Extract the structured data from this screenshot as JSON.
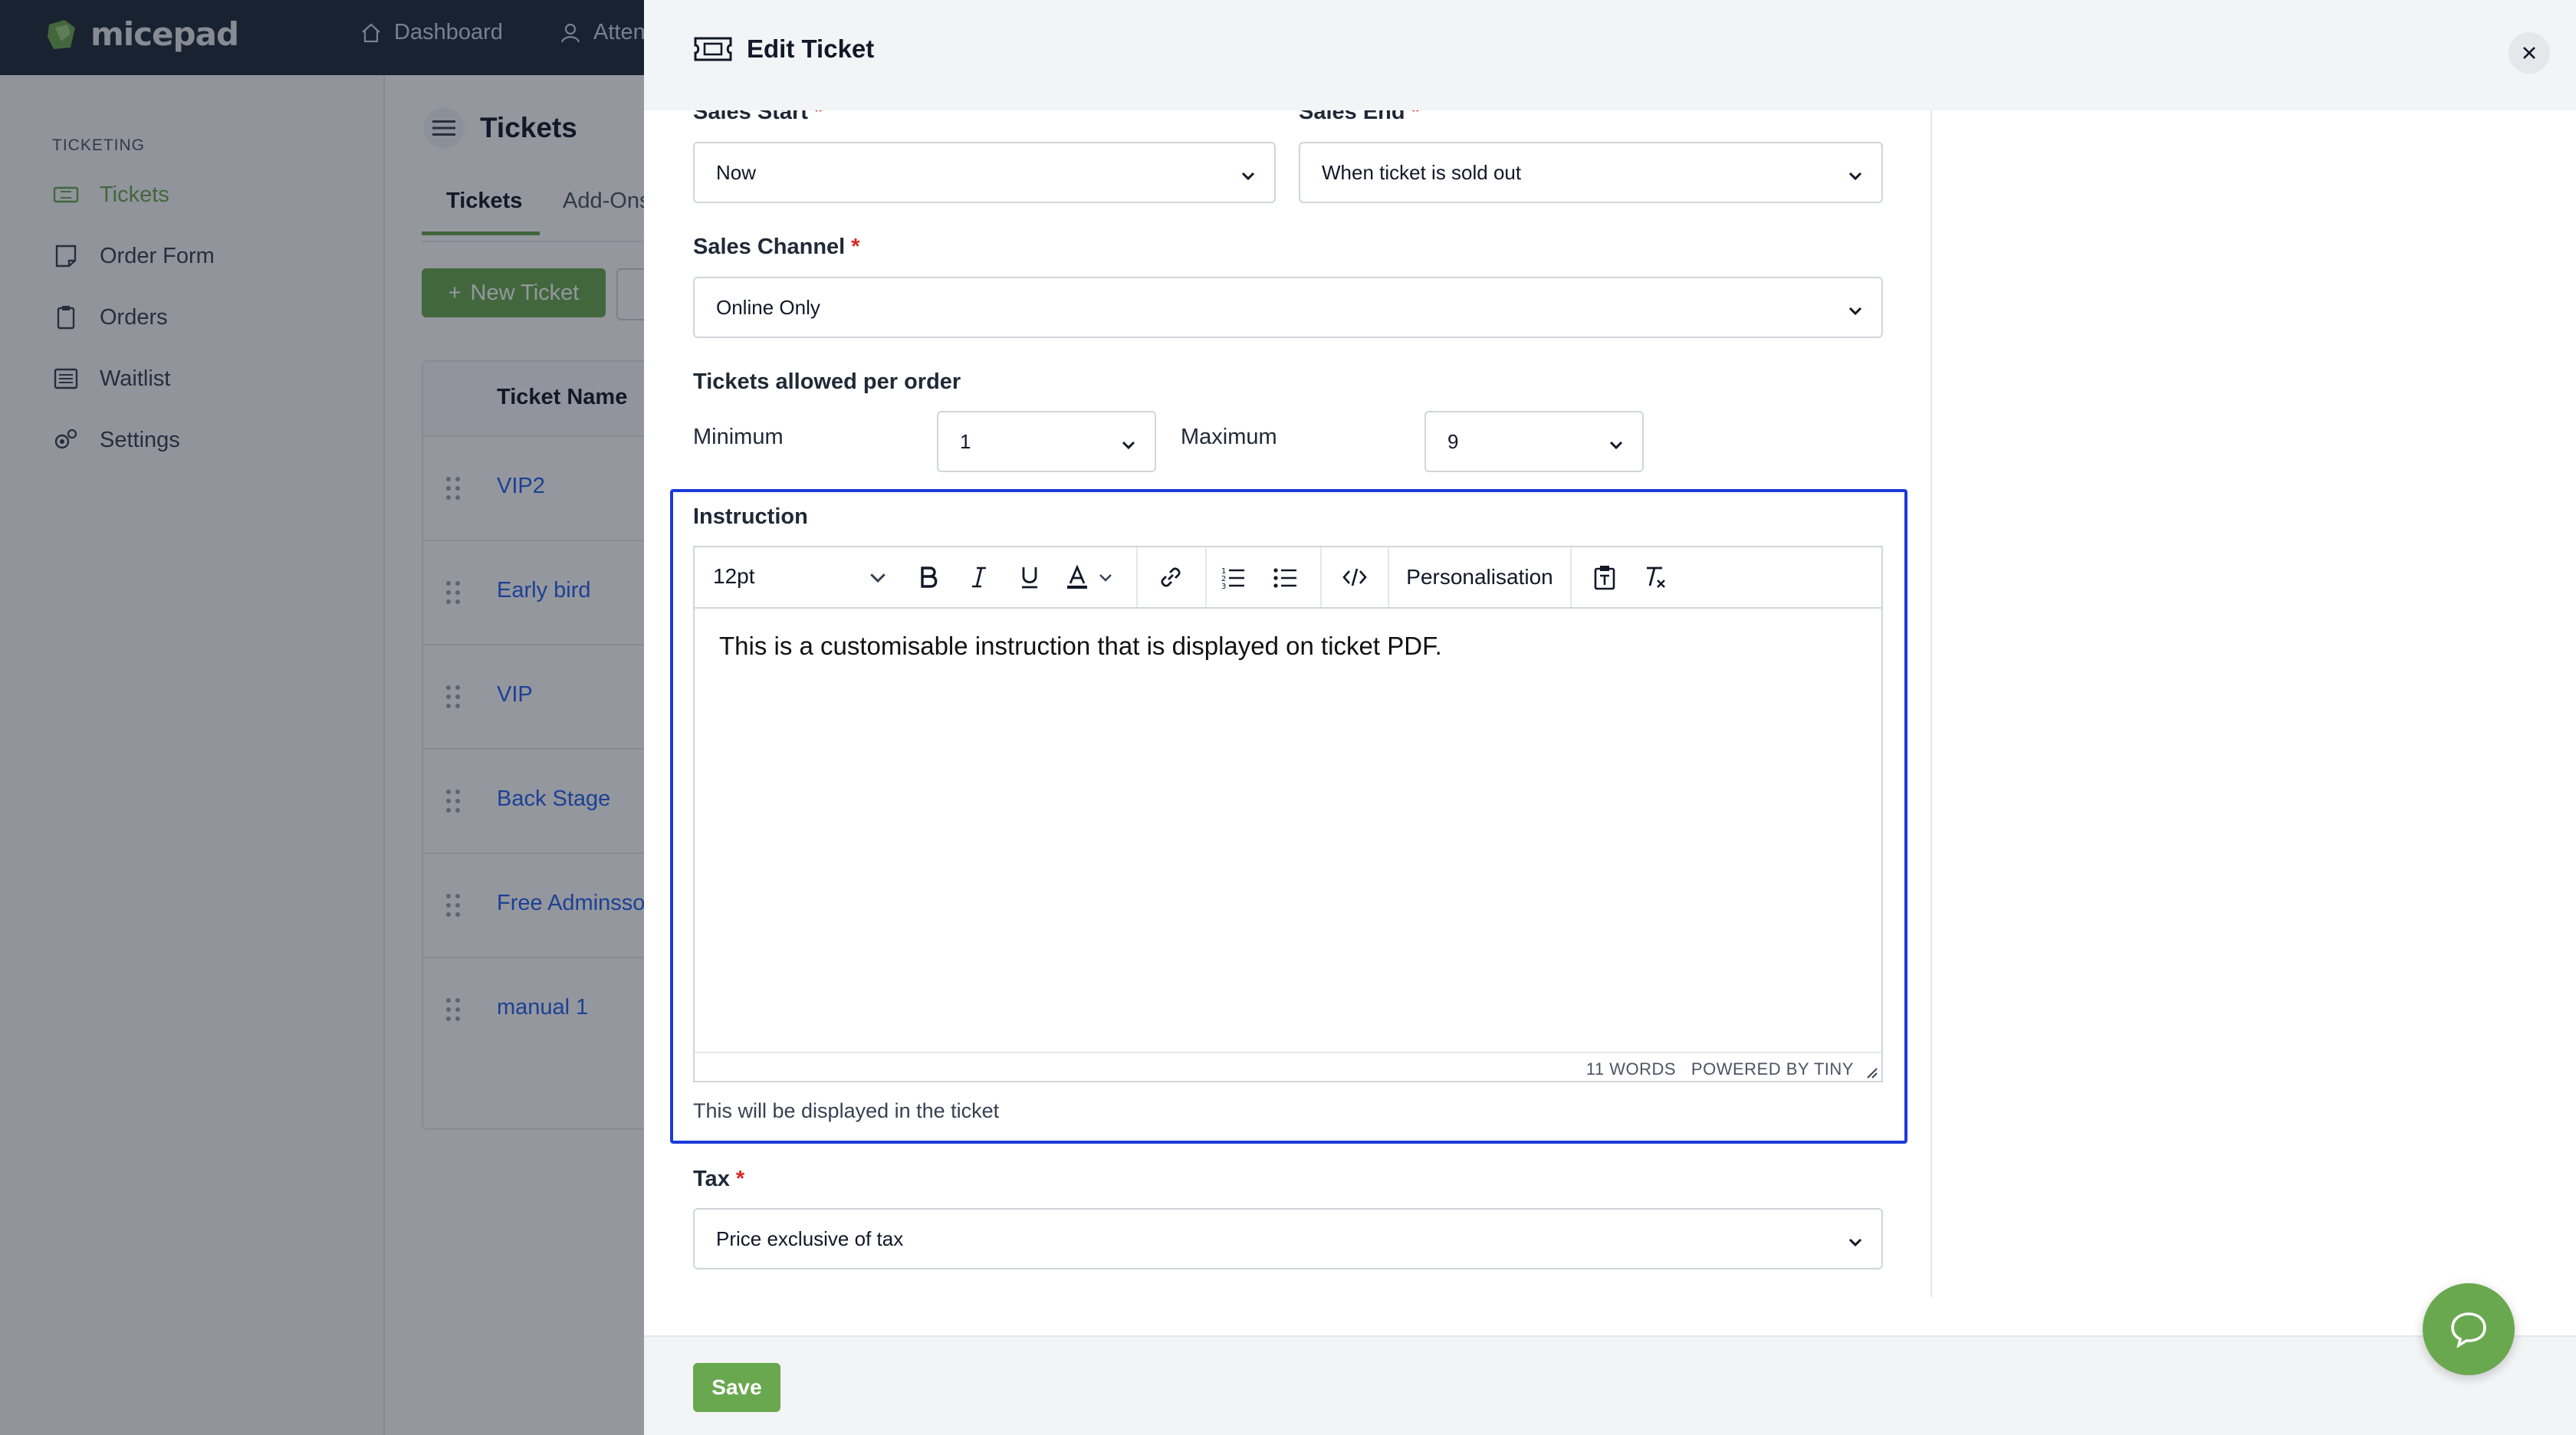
{
  "app": {
    "logo_text": "micepad",
    "nav": [
      {
        "label": "Dashboard",
        "icon": "home-icon"
      },
      {
        "label": "Atten",
        "icon": "user-icon"
      }
    ]
  },
  "sidebar": {
    "section": "TICKETING",
    "items": [
      {
        "label": "Tickets",
        "icon": "ticket-icon",
        "active": true
      },
      {
        "label": "Order Form",
        "icon": "form-icon"
      },
      {
        "label": "Orders",
        "icon": "clipboard-icon"
      },
      {
        "label": "Waitlist",
        "icon": "list-icon"
      },
      {
        "label": "Settings",
        "icon": "gear-icon"
      }
    ]
  },
  "main": {
    "title": "Tickets",
    "tabs": [
      {
        "label": "Tickets"
      },
      {
        "label": "Add-Ons"
      }
    ],
    "new_button": "New Ticket",
    "table": {
      "header": "Ticket Name",
      "rows": [
        "VIP2",
        "Early bird",
        "VIP",
        "Back Stage",
        "Free Adminssoin",
        "manual 1"
      ]
    }
  },
  "drawer": {
    "title": "Edit Ticket",
    "sales_start": {
      "label": "Sales Start",
      "value": "Now"
    },
    "sales_end": {
      "label": "Sales End",
      "value": "When ticket is sold out"
    },
    "sales_channel": {
      "label": "Sales Channel",
      "value": "Online Only"
    },
    "tickets_per_order": {
      "label": "Tickets allowed per order",
      "min_label": "Minimum",
      "min_value": "1",
      "max_label": "Maximum",
      "max_value": "9"
    },
    "instruction": {
      "label": "Instruction",
      "font_size": "12pt",
      "personalisation": "Personalisation",
      "content": "This is a customisable instruction that is displayed on ticket PDF.",
      "word_count": "11 WORDS",
      "powered_by": "POWERED BY TINY",
      "hint": "This will be displayed in the ticket"
    },
    "tax": {
      "label": "Tax",
      "value": "Price exclusive of tax"
    },
    "save_label": "Save",
    "required_mark": "*"
  },
  "colors": {
    "accent": "#6aa84f",
    "highlight": "#1d3bd8",
    "link": "#2563eb",
    "required": "#dc2626"
  }
}
